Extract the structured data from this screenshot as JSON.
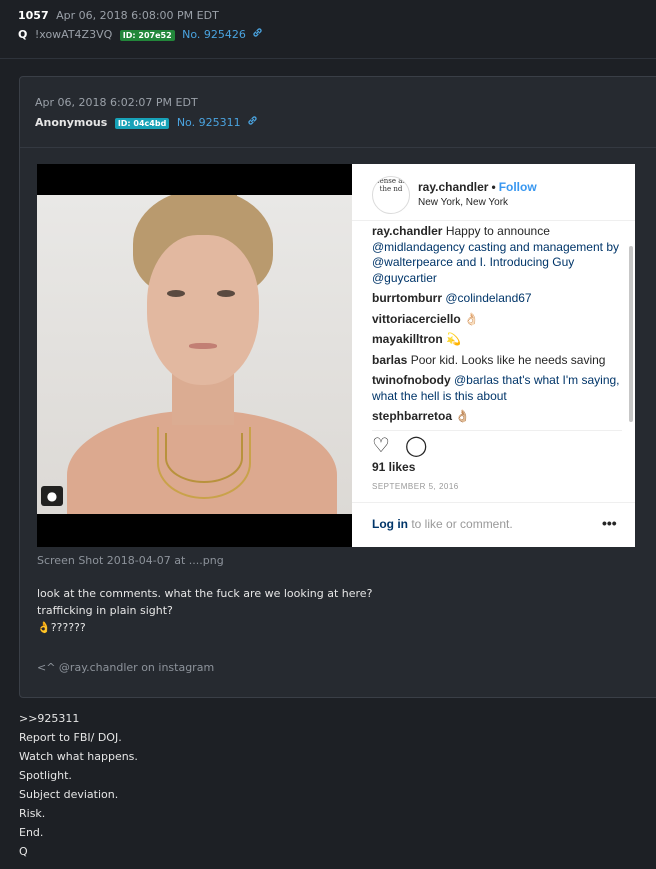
{
  "post": {
    "number": "1057",
    "timestamp": "Apr 06, 2018 6:08:00 PM EDT",
    "author": "Q",
    "tripcode": "!xowAT4Z3VQ",
    "id_badge": "ID: 207e52",
    "post_no": "No. 925426",
    "link_icon": "link-icon",
    "reply_lines": [
      ">>925311",
      "Report to FBI/ DOJ.",
      "Watch what happens.",
      "Spotlight.",
      "Subject deviation.",
      "Risk.",
      "End.",
      "Q"
    ]
  },
  "quoted": {
    "timestamp": "Apr 06, 2018 6:02:07 PM EDT",
    "author": "Anonymous",
    "id_badge": "ID: 04c4bd",
    "post_no": "No. 925311",
    "caption": "Screen Shot 2018-04-07 at ....png",
    "body_lines": [
      "look at the comments. what the fuck are we looking at here?",
      "trafficking in plain sight?",
      "👌??????"
    ],
    "signature": "<^ @ray.chandler on instagram"
  },
  "instagram": {
    "username": "ray.chandler",
    "dot": "•",
    "follow": "Follow",
    "location": "New York, New York",
    "avatar_text": "sense as the nd",
    "comments": [
      {
        "user": "ray.chandler",
        "text": " Happy to announce ",
        "mentions": "@midlandagency casting and management by @walterpearce and I. Introducing Guy @guycartier"
      },
      {
        "user": "burrtomburr",
        "text": " ",
        "mentions": "@colindeland67"
      },
      {
        "user": "vittoriacerciello",
        "text": " 👌🏻",
        "mentions": ""
      },
      {
        "user": "mayakilltron",
        "text": " 💫",
        "mentions": ""
      },
      {
        "user": "barlas",
        "text": " Poor kid. Looks like he needs saving",
        "mentions": ""
      },
      {
        "user": "twinofnobody",
        "text": " ",
        "mentions": "@barlas that's what I'm saying, what the hell is this about"
      },
      {
        "user": "stephbarretoa",
        "text": " 👌🏼",
        "mentions": ""
      }
    ],
    "likes": "91 likes",
    "date": "SEPTEMBER 5, 2016",
    "login_link": "Log in",
    "login_rest": " to like or comment.",
    "more": "•••",
    "heart_icon": "♡",
    "comment_icon": "◯"
  },
  "colors": {
    "background": "#1d2025",
    "quote_bg": "#262a30",
    "link": "#4aa3df",
    "id_green": "#22863a",
    "id_cyan": "#17a2b8"
  }
}
